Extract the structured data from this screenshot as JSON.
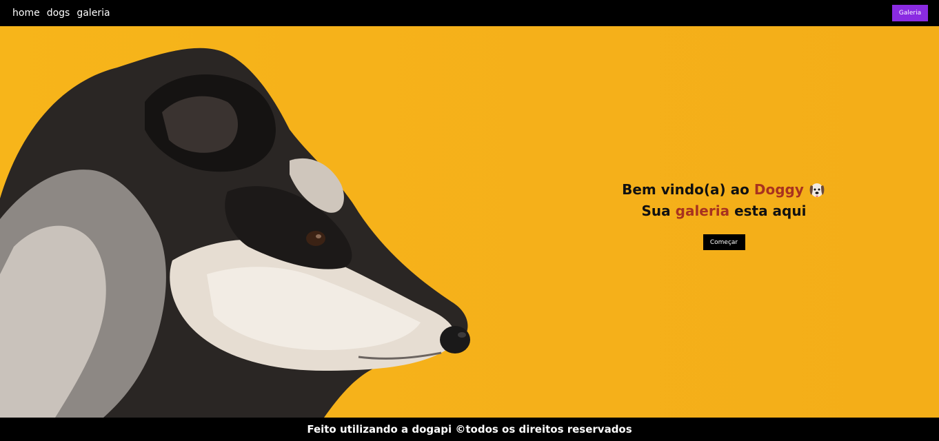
{
  "nav": {
    "links": [
      "home",
      "dogs",
      "galeria"
    ],
    "button_label": "Galeria"
  },
  "hero": {
    "line1": {
      "prefix": "Bem vindo(a) ao ",
      "highlight": "Doggy"
    },
    "line2": {
      "prefix": "Sua ",
      "highlight": "galeria",
      "suffix": " esta aqui"
    },
    "emoji_icon": "dog-face-icon",
    "start_button_label": "Começar",
    "photo": "dog-profile-photo"
  },
  "footer": {
    "text": "Feito utilizando a dogapi ©todos os direitos reservados"
  },
  "colors": {
    "background_yellow": "#f7b51a",
    "accent_red": "#a8321f",
    "button_purple": "#8a2be2",
    "bar_black": "#000000"
  }
}
